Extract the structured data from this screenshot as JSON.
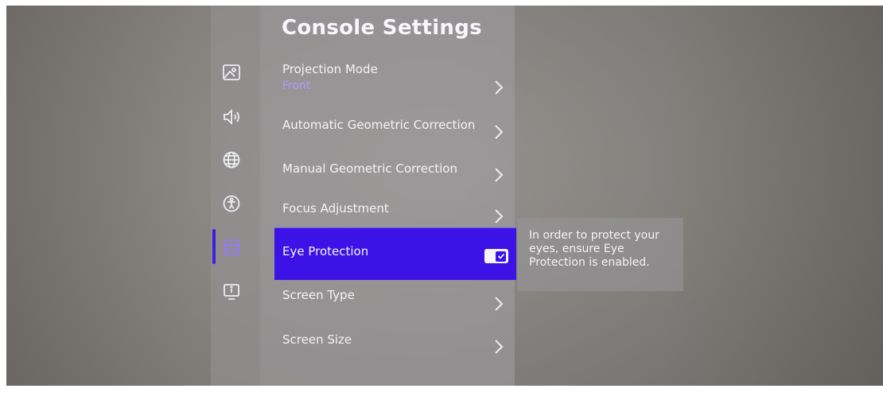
{
  "page": {
    "title": "Console Settings"
  },
  "sidebar": {
    "icons": [
      {
        "name": "picture-icon"
      },
      {
        "name": "sound-icon"
      },
      {
        "name": "globe-icon"
      },
      {
        "name": "accessibility-icon"
      },
      {
        "name": "console-icon",
        "active": true
      },
      {
        "name": "info-screen-icon"
      }
    ]
  },
  "menu": {
    "items": [
      {
        "label": "Projection Mode",
        "value": "Front",
        "control": "chevron-right-icon"
      },
      {
        "label": "Automatic Geometric Correction",
        "control": "chevron-right-icon"
      },
      {
        "label": "Manual Geometric Correction",
        "control": "chevron-right-icon"
      },
      {
        "label": "Focus Adjustment",
        "control": "chevron-right-icon"
      },
      {
        "label": "Eye Protection",
        "control": "checkbox-toggle",
        "checked": true,
        "selected": true
      },
      {
        "label": "Screen Type",
        "control": "chevron-right-icon"
      },
      {
        "label": "Screen Size",
        "control": "chevron-right-icon"
      }
    ]
  },
  "tooltip": {
    "text": "In order to protect your eyes, ensure Eye Protection is enabled."
  },
  "colors": {
    "accent": "#3d12e6",
    "value_text": "#a99cff",
    "panel_text": "#f3f3f7"
  }
}
